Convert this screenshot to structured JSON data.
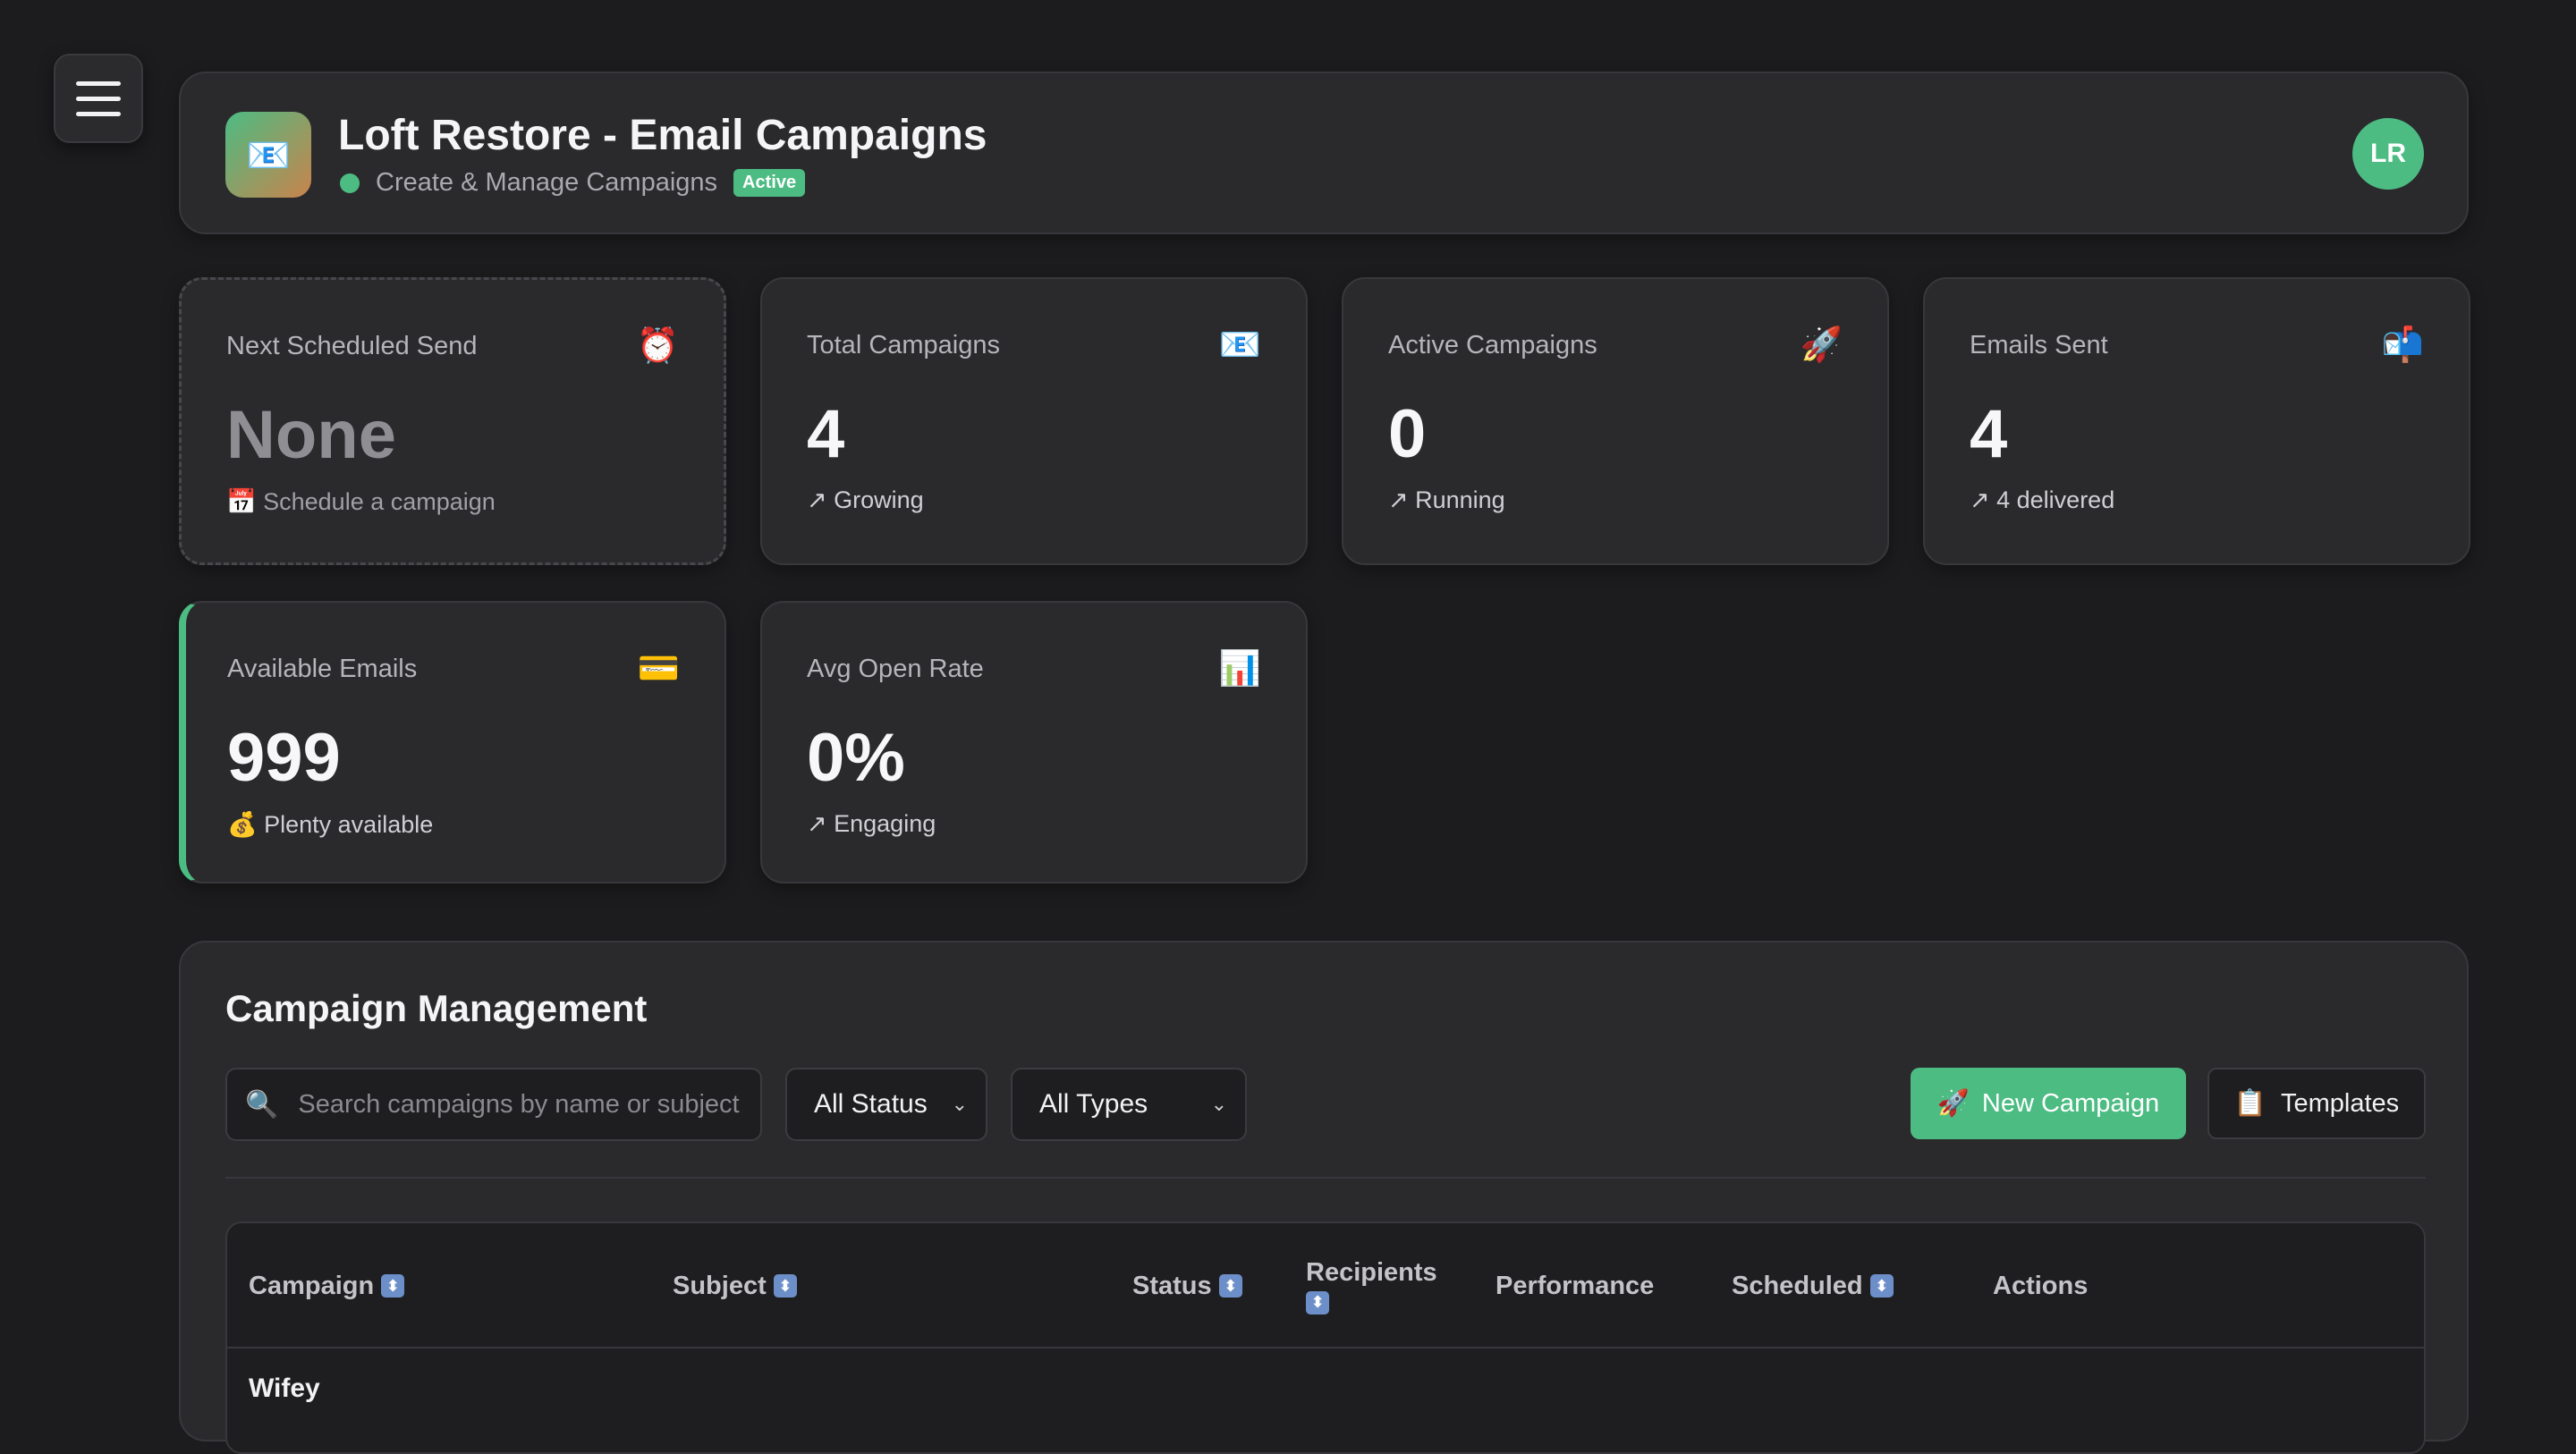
{
  "header": {
    "logo_icon": "📧",
    "title": "Loft Restore - Email Campaigns",
    "subtitle": "Create & Manage Campaigns",
    "badge": "Active",
    "avatar_initials": "LR"
  },
  "stats": [
    {
      "label": "Next Scheduled Send",
      "icon": "⏰",
      "value": "None",
      "footer": "📅 Schedule a campaign"
    },
    {
      "label": "Total Campaigns",
      "icon": "📧",
      "value": "4",
      "footer": "↗ Growing"
    },
    {
      "label": "Active Campaigns",
      "icon": "🚀",
      "value": "0",
      "footer": "↗ Running"
    },
    {
      "label": "Emails Sent",
      "icon": "📬",
      "value": "4",
      "footer": "↗ 4 delivered"
    },
    {
      "label": "Available Emails",
      "icon": "💳",
      "value": "999",
      "footer": "💰 Plenty available"
    },
    {
      "label": "Avg Open Rate",
      "icon": "📊",
      "value": "0%",
      "footer": "↗ Engaging"
    }
  ],
  "campaigns": {
    "title": "Campaign Management",
    "search_placeholder": "Search campaigns by name or subject",
    "status_filter": "All Status",
    "type_filter": "All Types",
    "new_button_icon": "🚀",
    "new_button": "New Campaign",
    "templates_button_icon": "📋",
    "templates_button": "Templates",
    "columns": [
      "Campaign",
      "Subject",
      "Status",
      "Recipients",
      "Performance",
      "Scheduled",
      "Actions"
    ],
    "sort_icon": "⬍",
    "rows": [
      {
        "campaign": "Wifey"
      }
    ]
  },
  "colors": {
    "accent": "#4cbc83",
    "background": "#1c1c1e",
    "card": "#2a2a2d"
  }
}
